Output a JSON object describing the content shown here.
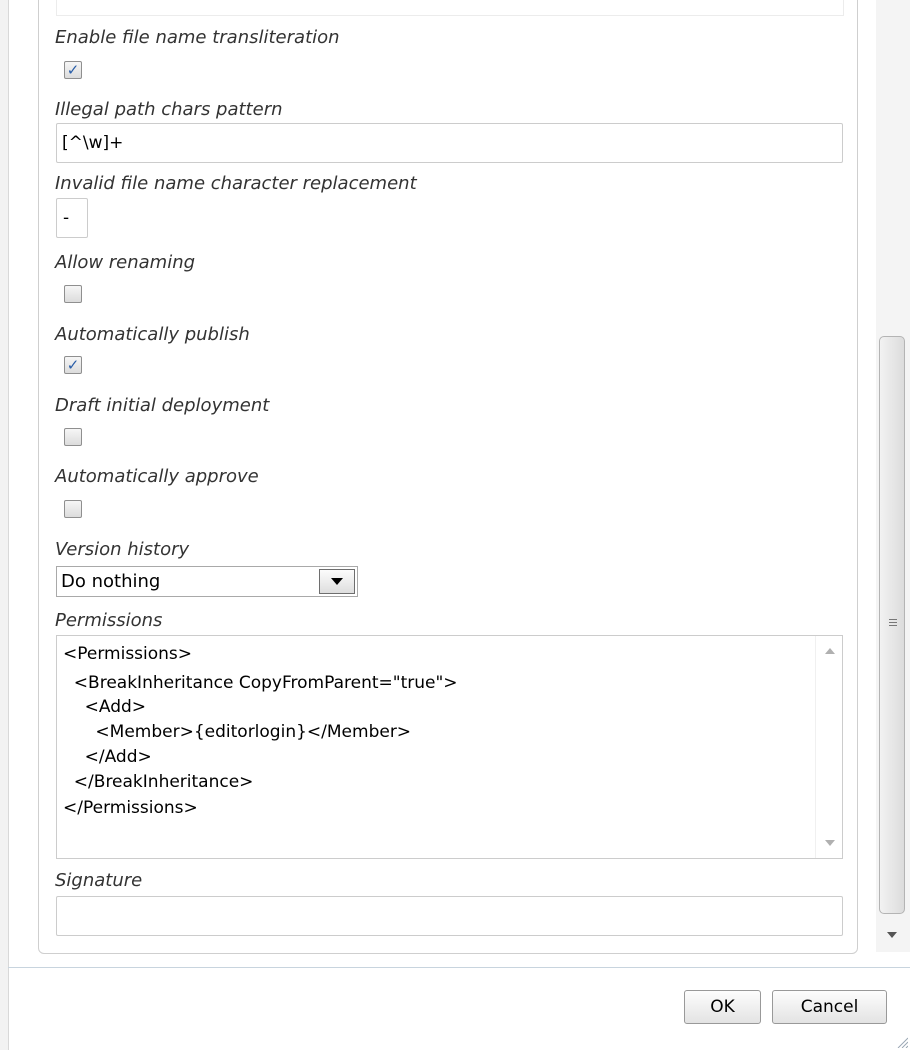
{
  "fields": {
    "transliteration": {
      "label": "Enable file name transliteration",
      "checked": true
    },
    "illegal_path": {
      "label": "Illegal path chars pattern",
      "value": "[^\\w]+"
    },
    "invalid_replacement": {
      "label": "Invalid file name character replacement",
      "value": "-"
    },
    "allow_renaming": {
      "label": "Allow renaming",
      "checked": false
    },
    "auto_publish": {
      "label": "Automatically publish",
      "checked": true
    },
    "draft_initial": {
      "label": "Draft initial deployment",
      "checked": false
    },
    "auto_approve": {
      "label": "Automatically approve",
      "checked": false
    },
    "version_history": {
      "label": "Version history",
      "selected": "Do nothing"
    },
    "permissions": {
      "label": "Permissions",
      "lines": [
        "<Permissions>",
        "  <BreakInheritance CopyFromParent=\"true\">",
        "    <Add>",
        "      <Member>{editorlogin}</Member>",
        "    </Add>",
        "  </BreakInheritance>",
        "</Permissions>"
      ]
    },
    "signature": {
      "label": "Signature",
      "value": ""
    }
  },
  "buttons": {
    "ok": "OK",
    "cancel": "Cancel"
  },
  "icons": {
    "check": "checkmark-icon",
    "dropdown": "chevron-down-icon",
    "scroll_up": "scroll-up-arrow-icon",
    "scroll_down": "scroll-down-arrow-icon",
    "resize": "resize-grip-icon"
  },
  "colors": {
    "check": "#2a5ea8",
    "label": "#333333",
    "divider": "#c8d4de"
  }
}
